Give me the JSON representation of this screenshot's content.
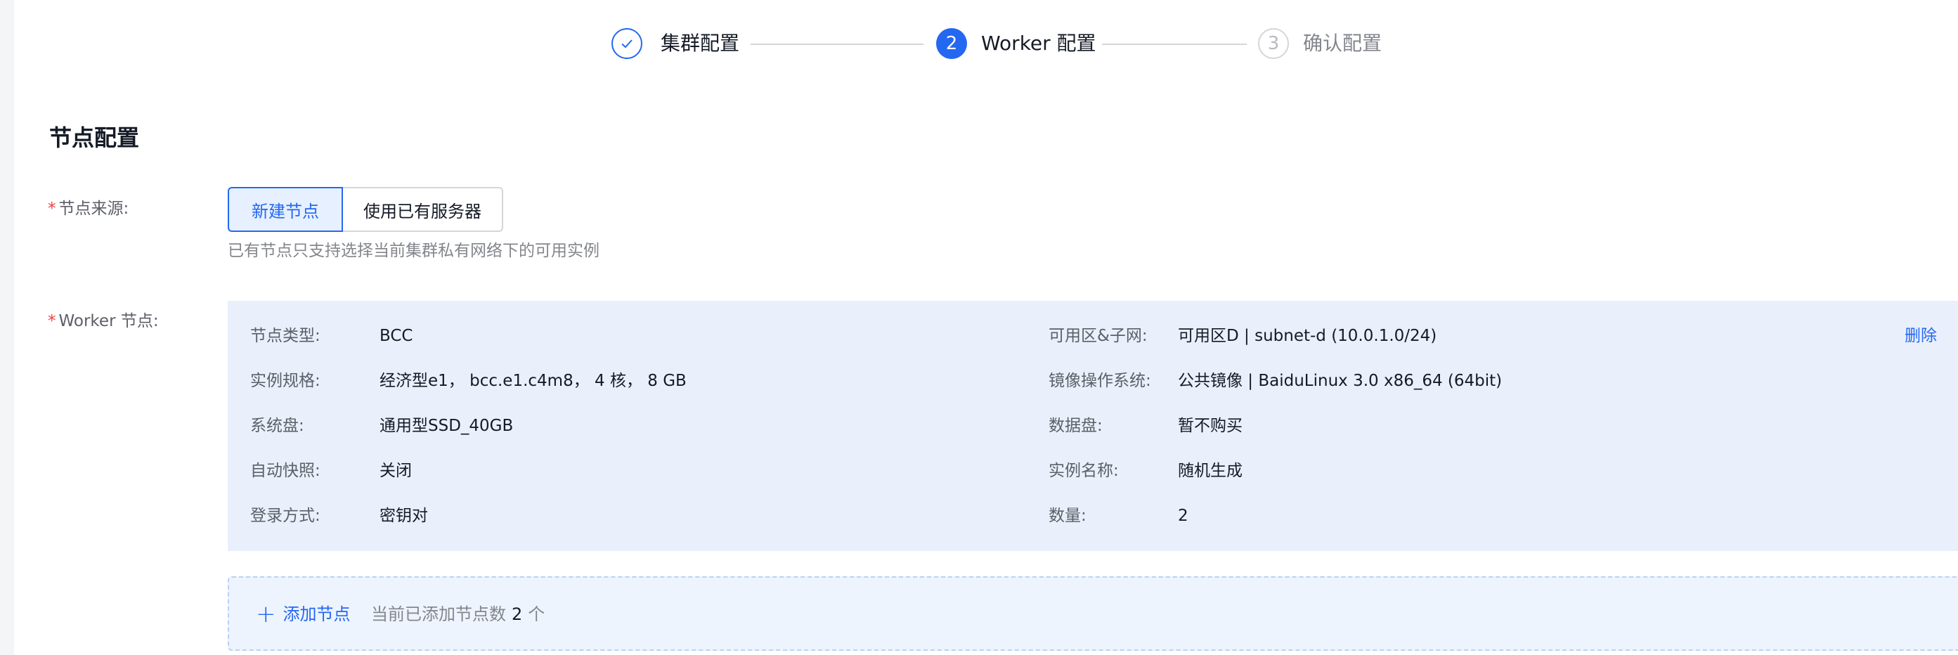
{
  "steps": [
    {
      "label": "集群配置",
      "state": "done",
      "icon": "check-icon"
    },
    {
      "number": "2",
      "label": "Worker 配置",
      "state": "active"
    },
    {
      "number": "3",
      "label": "确认配置",
      "state": "wait"
    }
  ],
  "section_title": "节点配置",
  "node_source": {
    "label": "节点来源:",
    "options": [
      "新建节点",
      "使用已有服务器"
    ],
    "selected": "新建节点",
    "hint": "已有节点只支持选择当前集群私有网络下的可用实例"
  },
  "worker": {
    "label": "Worker 节点:",
    "delete_label": "删除",
    "left": [
      {
        "key": "节点类型:",
        "value": "BCC"
      },
      {
        "key": "实例规格:",
        "value": "经济型e1， bcc.e1.c4m8， 4 核， 8 GB"
      },
      {
        "key": "系统盘:",
        "value": "通用型SSD_40GB"
      },
      {
        "key": "自动快照:",
        "value": "关闭"
      },
      {
        "key": "登录方式:",
        "value": "密钥对"
      }
    ],
    "right": [
      {
        "key": "可用区&子网:",
        "value": "可用区D | subnet-d (10.0.1.0/24)"
      },
      {
        "key": "镜像操作系统:",
        "value": "公共镜像 | BaiduLinux 3.0 x86_64 (64bit)"
      },
      {
        "key": "数据盘:",
        "value": "暂不购买"
      },
      {
        "key": "实例名称:",
        "value": "随机生成"
      },
      {
        "key": "数量:",
        "value": "2"
      }
    ]
  },
  "add_node": {
    "button_label": "添加节点",
    "info_prefix": "当前已添加节点数",
    "count": "2",
    "unit": "个"
  },
  "colors": {
    "primary": "#2468f2",
    "card_bg": "#e9f0fc",
    "required": "#f33e3e"
  }
}
